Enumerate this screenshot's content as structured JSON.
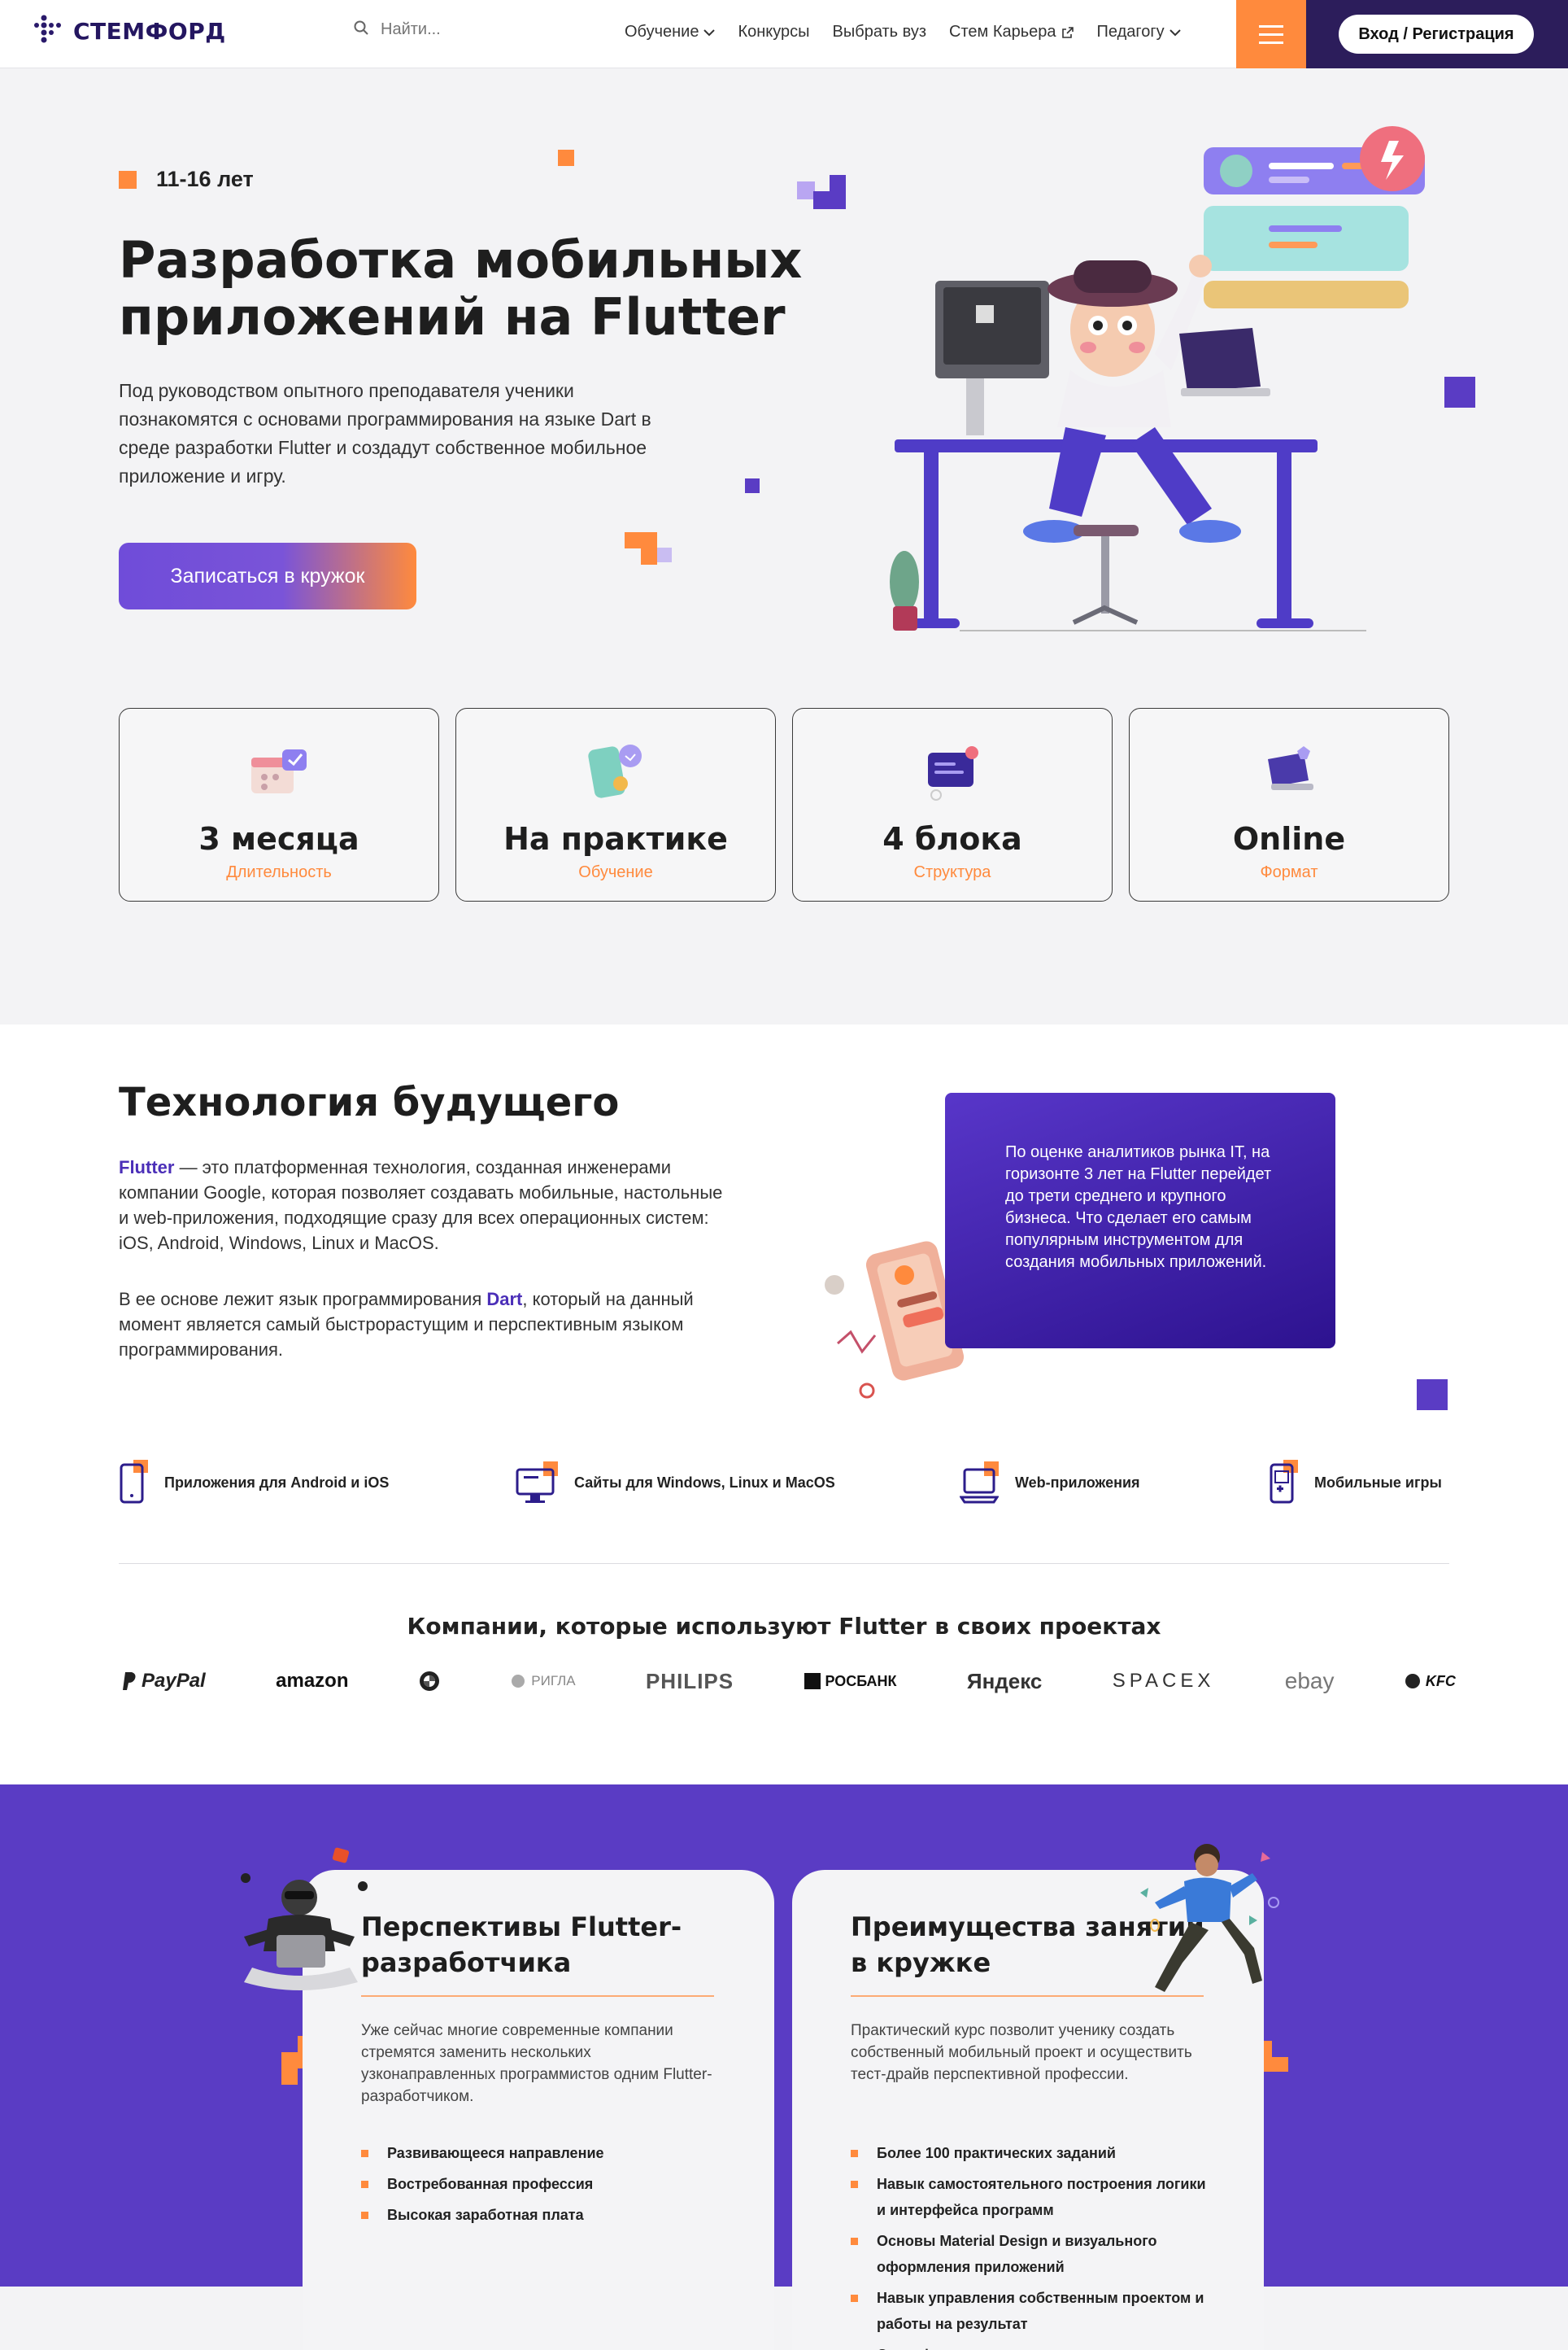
{
  "header": {
    "logo_text": "СТЕМФОРД",
    "search_placeholder": "Найти...",
    "nav": [
      {
        "label": "Обучение",
        "dropdown": true
      },
      {
        "label": "Конкурсы"
      },
      {
        "label": "Выбрать вуз"
      },
      {
        "label": "Стем Карьера",
        "external": true
      },
      {
        "label": "Педагогу",
        "dropdown": true
      }
    ],
    "login_label": "Вход / Регистрация"
  },
  "hero": {
    "age": "11-16 лет",
    "title": "Разработка мобильных приложений на Flutter",
    "text": "Под руководством опытного преподавателя ученики познакомятся с основами программирования на языке Dart в среде разработки Flutter и создадут собственное мобильное приложение и игру.",
    "cta": "Записаться в кружок"
  },
  "stats": [
    {
      "value": "3 месяца",
      "label": "Длительность",
      "icon": "calendar-icon"
    },
    {
      "value": "На практике",
      "label": "Обучение",
      "icon": "chat-phone-icon"
    },
    {
      "value": "4 блока",
      "label": "Структура",
      "icon": "message-board-icon"
    },
    {
      "value": "Online",
      "label": "Формат",
      "icon": "laptop-icon"
    }
  ],
  "tech": {
    "title": "Технология будущего",
    "p1_strong": "Flutter",
    "p1_rest": " — это платформенная технология, созданная инженерами компании Google, которая позволяет создавать мобильные, настольные и web-приложения, подходящие сразу для всех операционных систем: iOS, Android, Windows, Linux и MacOS.",
    "p2_start": "В ее основе лежит язык программирования ",
    "p2_strong": "Dart",
    "p2_rest": ", который на данный момент является самый быстрорастущим и перспективным языком программирования.",
    "fact": "По оценке аналитиков рынка IT, на горизонте 3 лет на Flutter перейдет до трети среднего и крупного бизнеса. Что сделает его самым популярным инструментом для создания мобильных приложений."
  },
  "features": [
    {
      "label": "Приложения для Android и iOS",
      "icon": "smartphone-icon"
    },
    {
      "label": "Сайты для Windows, Linux и MacOS",
      "icon": "monitor-icon"
    },
    {
      "label": "Web-приложения",
      "icon": "laptop-icon"
    },
    {
      "label": "Мобильные игры",
      "icon": "gamepad-icon"
    }
  ],
  "companies": {
    "title": "Компании, которые используют Flutter в своих проектах",
    "logos": [
      "PayPal",
      "amazon",
      "BMW",
      "РИГЛА",
      "PHILIPS",
      "РОСБАНК",
      "Яндекс",
      "SPACEX",
      "ebay",
      "KFC"
    ]
  },
  "cards": [
    {
      "title": "Перспективы Flutter-разработчика",
      "text": "Уже сейчас многие современные компании стремятся заменить нескольких узконаправленных программистов одним Flutter-разработчиком.",
      "items": [
        "Развивающееся направление",
        "Востребованная профессия",
        "Высокая заработная плата"
      ]
    },
    {
      "title": "Преимущества занятий в кружке",
      "text": "Практический курс позволит ученику создать собственный мобильный проект и осуществить тест-драйв перспективной профессии.",
      "items": [
        "Более 100 практических заданий",
        "Навык самостоятельного построения логики и интерфейса программ",
        "Основы Material Design и визуального оформления приложений",
        "Навык управления собственным проектом и работы на результат",
        "Сертификат о прохождении"
      ]
    }
  ],
  "colors": {
    "accent": "#ff8a3d",
    "brand": "#5a3cc4",
    "dark": "#2c1d5b"
  }
}
